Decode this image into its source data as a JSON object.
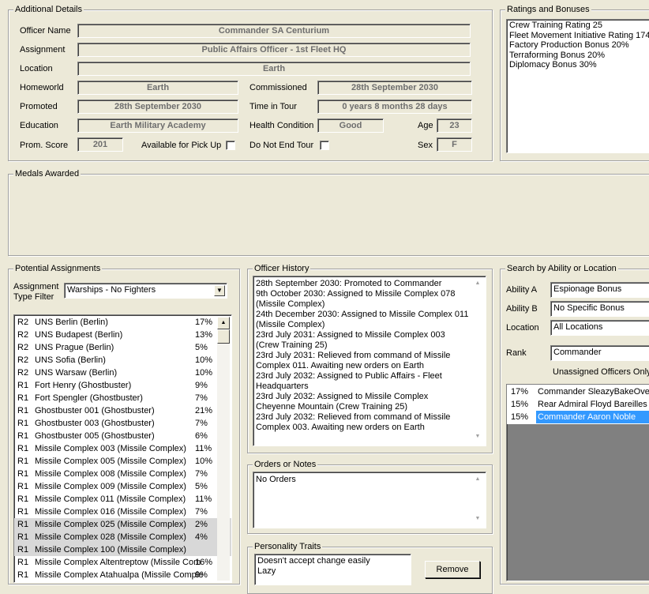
{
  "additional_details": {
    "legend": "Additional Details",
    "officer_name_label": "Officer Name",
    "officer_name": "Commander SA Centurium",
    "assignment_label": "Assignment",
    "assignment": "Public Affairs Officer - 1st Fleet HQ",
    "location_label": "Location",
    "location": "Earth",
    "homeworld_label": "Homeworld",
    "homeworld": "Earth",
    "commissioned_label": "Commissioned",
    "commissioned": "28th September 2030",
    "promoted_label": "Promoted",
    "promoted": "28th September 2030",
    "time_in_tour_label": "Time in Tour",
    "time_in_tour": "0 years 8 months 28 days",
    "education_label": "Education",
    "education": "Earth Military Academy",
    "health_label": "Health Condition",
    "health": "Good",
    "age_label": "Age",
    "age": "23",
    "prom_score_label": "Prom. Score",
    "prom_score": "201",
    "available_label": "Available for Pick Up",
    "do_not_end_label": "Do Not End Tour",
    "sex_label": "Sex",
    "sex": "F"
  },
  "ratings": {
    "legend": "Ratings and Bonuses",
    "items": [
      "Crew Training Rating 25",
      "Fleet Movement Initiative Rating 174",
      "Factory Production Bonus 20%",
      "Terraforming Bonus 20%",
      "Diplomacy Bonus 30%"
    ]
  },
  "medals": {
    "legend": "Medals Awarded"
  },
  "potential_assignments": {
    "legend": "Potential Assignments",
    "filter_label_1": "Assignment",
    "filter_label_2": "Type Filter",
    "filter_value": "Warships - No Fighters",
    "rows": [
      {
        "rank": "R2",
        "name": "UNS Berlin (Berlin)",
        "pct": "17%"
      },
      {
        "rank": "R2",
        "name": "UNS Budapest (Berlin)",
        "pct": "13%"
      },
      {
        "rank": "R2",
        "name": "UNS Prague (Berlin)",
        "pct": "5%"
      },
      {
        "rank": "R2",
        "name": "UNS Sofia (Berlin)",
        "pct": "10%"
      },
      {
        "rank": "R2",
        "name": "UNS Warsaw (Berlin)",
        "pct": "10%"
      },
      {
        "rank": "R1",
        "name": "Fort Henry (Ghostbuster)",
        "pct": "9%"
      },
      {
        "rank": "R1",
        "name": "Fort Spengler (Ghostbuster)",
        "pct": "7%"
      },
      {
        "rank": "R1",
        "name": "Ghostbuster 001 (Ghostbuster)",
        "pct": "21%"
      },
      {
        "rank": "R1",
        "name": "Ghostbuster 003 (Ghostbuster)",
        "pct": "7%"
      },
      {
        "rank": "R1",
        "name": "Ghostbuster 005 (Ghostbuster)",
        "pct": "6%"
      },
      {
        "rank": "R1",
        "name": "Missile Complex 003 (Missile Complex)",
        "pct": "11%"
      },
      {
        "rank": "R1",
        "name": "Missile Complex 005 (Missile Complex)",
        "pct": "10%"
      },
      {
        "rank": "R1",
        "name": "Missile Complex 008 (Missile Complex)",
        "pct": "7%"
      },
      {
        "rank": "R1",
        "name": "Missile Complex 009 (Missile Complex)",
        "pct": "5%"
      },
      {
        "rank": "R1",
        "name": "Missile Complex 011 (Missile Complex)",
        "pct": "11%"
      },
      {
        "rank": "R1",
        "name": "Missile Complex 016 (Missile Complex)",
        "pct": "7%"
      },
      {
        "rank": "R1",
        "name": "Missile Complex 025 (Missile Complex)",
        "pct": "2%"
      },
      {
        "rank": "R1",
        "name": "Missile Complex 028 (Missile Complex)",
        "pct": "4%"
      },
      {
        "rank": "R1",
        "name": "Missile Complex 100 (Missile Complex)",
        "pct": ""
      },
      {
        "rank": "R1",
        "name": "Missile Complex Altentreptow (Missile Com",
        "pct": "16%"
      },
      {
        "rank": "R1",
        "name": "Missile Complex Atahualpa (Missile Comple",
        "pct": "9%"
      }
    ]
  },
  "officer_history": {
    "legend": "Officer History",
    "entries": [
      "28th September 2030: Promoted to Commander",
      "9th October 2030: Assigned to Missile Complex 078 (Missile Complex)",
      "24th December 2030: Assigned to Missile Complex 011 (Missile Complex)",
      "23rd July 2031: Assigned to Missile Complex 003 (Crew Training 25)",
      "23rd July 2031: Relieved from command of Missile Complex 011. Awaiting new orders on Earth",
      "23rd July 2032: Assigned to Public Affairs - Fleet Headquarters",
      "23rd July 2032: Assigned to Missile Complex Cheyenne Mountain (Crew Training 25)",
      "23rd July 2032: Relieved from command of Missile Complex 003. Awaiting new orders on Earth"
    ]
  },
  "orders": {
    "legend": "Orders or Notes",
    "text": "No Orders"
  },
  "personality": {
    "legend": "Personality Traits",
    "traits": [
      "Doesn't accept change easily",
      "Lazy"
    ],
    "remove_label": "Remove"
  },
  "search": {
    "legend": "Search by Ability or Location",
    "ability_a_label": "Ability A",
    "ability_a": "Espionage Bonus",
    "ability_b_label": "Ability B",
    "ability_b": "No Specific Bonus",
    "location_label": "Location",
    "location": "All Locations",
    "rank_label": "Rank",
    "rank": "Commander",
    "unassigned_label": "Unassigned Officers Only",
    "results": [
      {
        "pct": "17%",
        "name": "Commander SleazyBakeOven"
      },
      {
        "pct": "15%",
        "name": "Rear Admiral Floyd Bareilles"
      },
      {
        "pct": "15%",
        "name": "Commander Aaron Noble"
      }
    ]
  },
  "colors": {
    "window_bg": "#ECE9D8",
    "selection": "#3399FF",
    "readonly_text": "#6E6E6E",
    "empty_list_bg": "#808080"
  }
}
